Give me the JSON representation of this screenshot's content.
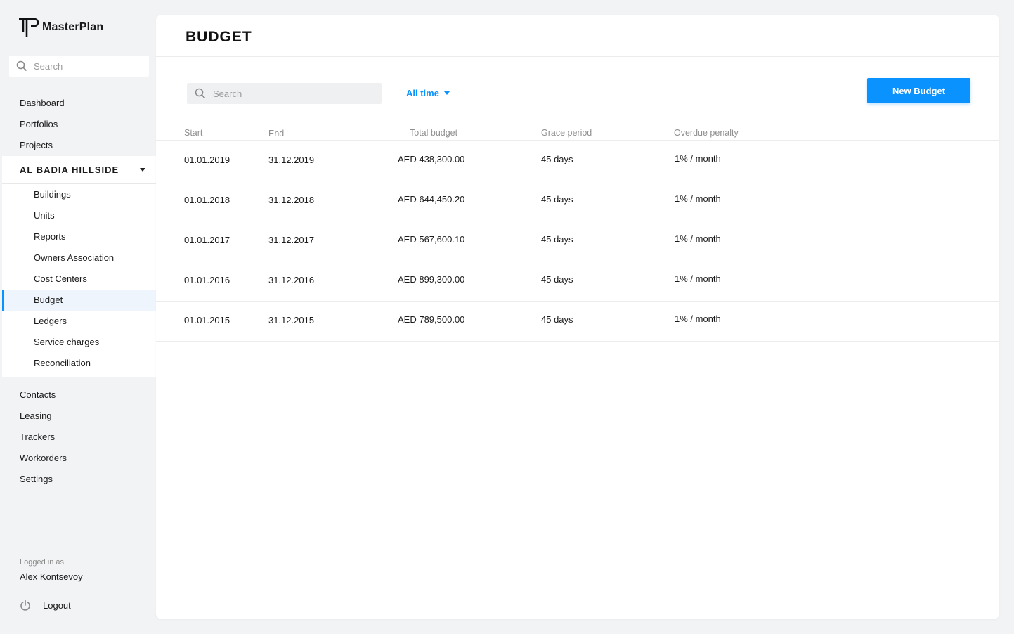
{
  "app": {
    "name": "MasterPlan"
  },
  "sidebar": {
    "search_placeholder": "Search",
    "nav_top": [
      "Dashboard",
      "Portfolios",
      "Projects"
    ],
    "project": {
      "name": "AL BADIA HILLSIDE",
      "items": [
        "Buildings",
        "Units",
        "Reports",
        "Owners Association",
        "Cost Centers",
        "Budget",
        "Ledgers",
        "Service charges",
        "Reconciliation"
      ],
      "active": "Budget"
    },
    "nav_bottom": [
      "Contacts",
      "Leasing",
      "Trackers",
      "Workorders",
      "Settings"
    ],
    "logged_in_label": "Logged in as",
    "user_name": "Alex Kontsevoy",
    "logout_label": "Logout"
  },
  "main": {
    "title": "BUDGET",
    "search_placeholder": "Search",
    "filter_label": "All time",
    "new_button_label": "New Budget",
    "table": {
      "headers": [
        "Start",
        "End",
        "Total budget",
        "Grace period",
        "Overdue penalty"
      ],
      "rows": [
        [
          "01.01.2019",
          "31.12.2019",
          "AED 438,300.00",
          "45 days",
          "1% / month"
        ],
        [
          "01.01.2018",
          "31.12.2018",
          "AED 644,450.20",
          "45 days",
          "1% / month"
        ],
        [
          "01.01.2017",
          "31.12.2017",
          "AED 567,600.10",
          "45 days",
          "1% / month"
        ],
        [
          "01.01.2016",
          "31.12.2016",
          "AED 899,300.00",
          "45 days",
          "1% / month"
        ],
        [
          "01.01.2015",
          "31.12.2015",
          "AED 789,500.00",
          "45 days",
          "1% / month"
        ]
      ]
    }
  },
  "colors": {
    "accent": "#0a93ff",
    "active_bg": "#eef5fd",
    "page_bg": "#f2f3f5"
  },
  "icons": {
    "logo": "masterplan-logo-icon",
    "search": "search-icon",
    "caret": "chevron-down-icon",
    "logout": "power-icon"
  }
}
